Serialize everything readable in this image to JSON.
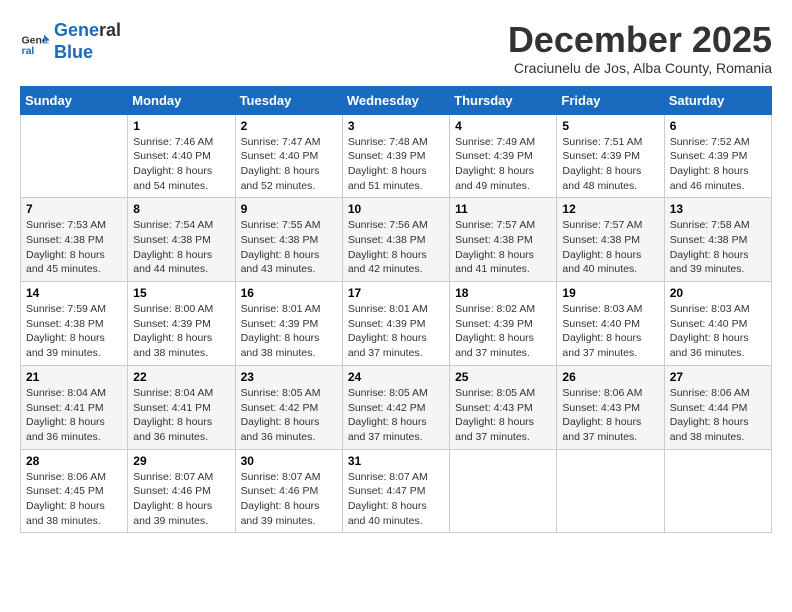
{
  "logo": {
    "line1": "General",
    "line2": "Blue"
  },
  "title": "December 2025",
  "subtitle": "Craciunelu de Jos, Alba County, Romania",
  "days_of_week": [
    "Sunday",
    "Monday",
    "Tuesday",
    "Wednesday",
    "Thursday",
    "Friday",
    "Saturday"
  ],
  "weeks": [
    [
      {
        "day": "",
        "info": ""
      },
      {
        "day": "1",
        "info": "Sunrise: 7:46 AM\nSunset: 4:40 PM\nDaylight: 8 hours\nand 54 minutes."
      },
      {
        "day": "2",
        "info": "Sunrise: 7:47 AM\nSunset: 4:40 PM\nDaylight: 8 hours\nand 52 minutes."
      },
      {
        "day": "3",
        "info": "Sunrise: 7:48 AM\nSunset: 4:39 PM\nDaylight: 8 hours\nand 51 minutes."
      },
      {
        "day": "4",
        "info": "Sunrise: 7:49 AM\nSunset: 4:39 PM\nDaylight: 8 hours\nand 49 minutes."
      },
      {
        "day": "5",
        "info": "Sunrise: 7:51 AM\nSunset: 4:39 PM\nDaylight: 8 hours\nand 48 minutes."
      },
      {
        "day": "6",
        "info": "Sunrise: 7:52 AM\nSunset: 4:39 PM\nDaylight: 8 hours\nand 46 minutes."
      }
    ],
    [
      {
        "day": "7",
        "info": "Sunrise: 7:53 AM\nSunset: 4:38 PM\nDaylight: 8 hours\nand 45 minutes."
      },
      {
        "day": "8",
        "info": "Sunrise: 7:54 AM\nSunset: 4:38 PM\nDaylight: 8 hours\nand 44 minutes."
      },
      {
        "day": "9",
        "info": "Sunrise: 7:55 AM\nSunset: 4:38 PM\nDaylight: 8 hours\nand 43 minutes."
      },
      {
        "day": "10",
        "info": "Sunrise: 7:56 AM\nSunset: 4:38 PM\nDaylight: 8 hours\nand 42 minutes."
      },
      {
        "day": "11",
        "info": "Sunrise: 7:57 AM\nSunset: 4:38 PM\nDaylight: 8 hours\nand 41 minutes."
      },
      {
        "day": "12",
        "info": "Sunrise: 7:57 AM\nSunset: 4:38 PM\nDaylight: 8 hours\nand 40 minutes."
      },
      {
        "day": "13",
        "info": "Sunrise: 7:58 AM\nSunset: 4:38 PM\nDaylight: 8 hours\nand 39 minutes."
      }
    ],
    [
      {
        "day": "14",
        "info": "Sunrise: 7:59 AM\nSunset: 4:38 PM\nDaylight: 8 hours\nand 39 minutes."
      },
      {
        "day": "15",
        "info": "Sunrise: 8:00 AM\nSunset: 4:39 PM\nDaylight: 8 hours\nand 38 minutes."
      },
      {
        "day": "16",
        "info": "Sunrise: 8:01 AM\nSunset: 4:39 PM\nDaylight: 8 hours\nand 38 minutes."
      },
      {
        "day": "17",
        "info": "Sunrise: 8:01 AM\nSunset: 4:39 PM\nDaylight: 8 hours\nand 37 minutes."
      },
      {
        "day": "18",
        "info": "Sunrise: 8:02 AM\nSunset: 4:39 PM\nDaylight: 8 hours\nand 37 minutes."
      },
      {
        "day": "19",
        "info": "Sunrise: 8:03 AM\nSunset: 4:40 PM\nDaylight: 8 hours\nand 37 minutes."
      },
      {
        "day": "20",
        "info": "Sunrise: 8:03 AM\nSunset: 4:40 PM\nDaylight: 8 hours\nand 36 minutes."
      }
    ],
    [
      {
        "day": "21",
        "info": "Sunrise: 8:04 AM\nSunset: 4:41 PM\nDaylight: 8 hours\nand 36 minutes."
      },
      {
        "day": "22",
        "info": "Sunrise: 8:04 AM\nSunset: 4:41 PM\nDaylight: 8 hours\nand 36 minutes."
      },
      {
        "day": "23",
        "info": "Sunrise: 8:05 AM\nSunset: 4:42 PM\nDaylight: 8 hours\nand 36 minutes."
      },
      {
        "day": "24",
        "info": "Sunrise: 8:05 AM\nSunset: 4:42 PM\nDaylight: 8 hours\nand 37 minutes."
      },
      {
        "day": "25",
        "info": "Sunrise: 8:05 AM\nSunset: 4:43 PM\nDaylight: 8 hours\nand 37 minutes."
      },
      {
        "day": "26",
        "info": "Sunrise: 8:06 AM\nSunset: 4:43 PM\nDaylight: 8 hours\nand 37 minutes."
      },
      {
        "day": "27",
        "info": "Sunrise: 8:06 AM\nSunset: 4:44 PM\nDaylight: 8 hours\nand 38 minutes."
      }
    ],
    [
      {
        "day": "28",
        "info": "Sunrise: 8:06 AM\nSunset: 4:45 PM\nDaylight: 8 hours\nand 38 minutes."
      },
      {
        "day": "29",
        "info": "Sunrise: 8:07 AM\nSunset: 4:46 PM\nDaylight: 8 hours\nand 39 minutes."
      },
      {
        "day": "30",
        "info": "Sunrise: 8:07 AM\nSunset: 4:46 PM\nDaylight: 8 hours\nand 39 minutes."
      },
      {
        "day": "31",
        "info": "Sunrise: 8:07 AM\nSunset: 4:47 PM\nDaylight: 8 hours\nand 40 minutes."
      },
      {
        "day": "",
        "info": ""
      },
      {
        "day": "",
        "info": ""
      },
      {
        "day": "",
        "info": ""
      }
    ]
  ]
}
